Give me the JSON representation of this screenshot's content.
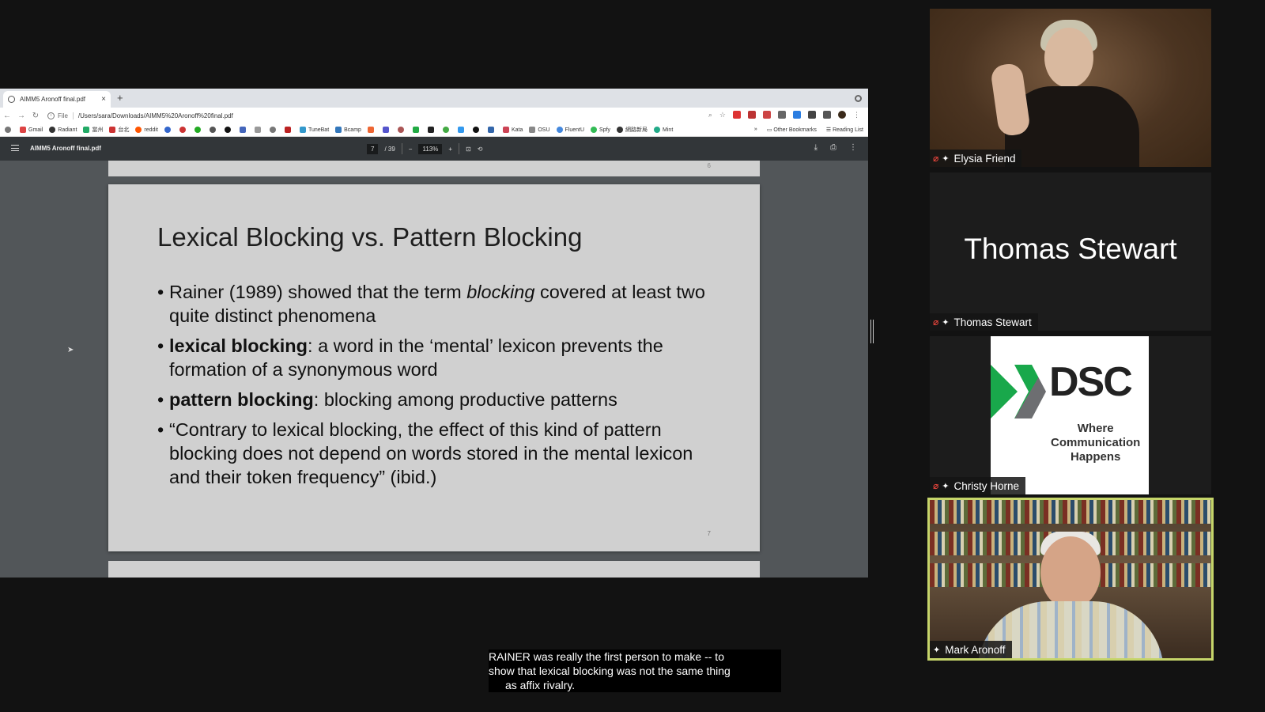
{
  "browser": {
    "tab_title": "AIMM5 Aronoff final.pdf",
    "new_tab": "+",
    "close": "×",
    "address_scheme": "File",
    "address_url": "/Users/sara/Downloads/AIMM5%20Aronoff%20final.pdf",
    "bookmarks": [
      "Gmail",
      "Radiant",
      "當州",
      "台北",
      "reddit",
      "TuneBat",
      "Bcamp",
      "Kata",
      "OSU",
      "FluentU",
      "Spfy",
      "網路新局",
      "Mint"
    ],
    "bookmarks_overflow": "»",
    "other_bookmarks": "Other Bookmarks",
    "reading_list": "Reading List"
  },
  "pdf_toolbar": {
    "filename": "AIMM5 Aronoff final.pdf",
    "current_page": "7",
    "total_pages": "/ 39",
    "zoom": "113%",
    "zoom_out": "−",
    "zoom_in": "+"
  },
  "slide": {
    "prev_page_number": "6",
    "title": "Lexical Blocking vs. Pattern Blocking",
    "bullet1_a": "Rainer (1989) showed that the term ",
    "bullet1_em": "blocking",
    "bullet1_b": " covered at least two quite distinct phenomena",
    "bullet2_bold": "lexical blocking",
    "bullet2_rest": ": a word in the ‘mental’ lexicon prevents the formation of a synonymous word",
    "bullet3_bold": "pattern blocking",
    "bullet3_rest": ": blocking among productive patterns",
    "bullet4": "“Contrary to lexical blocking, the effect of this kind of pattern blocking does not depend on words stored in the mental lexicon and their token frequency” (ibid.)",
    "page_number": "7"
  },
  "participants": [
    {
      "name": "Elysia Friend",
      "muted": true
    },
    {
      "name": "Thomas Stewart",
      "muted": true,
      "display_name": "Thomas Stewart"
    },
    {
      "name": "Christy Horne",
      "muted": true,
      "logo_word": "DSC",
      "logo_tagline_1": "Where",
      "logo_tagline_2": "Communication",
      "logo_tagline_3": "Happens"
    },
    {
      "name": "Mark Aronoff",
      "muted": false,
      "active_speaker": true
    }
  ],
  "captions": {
    "line1": "RAINER was really the first person to make -- to",
    "line2": "show that lexical blocking was not the same thing",
    "line3": "as affix rivalry."
  },
  "colors": {
    "active_speaker_border": "#c6d56a",
    "mic_off": "#e8453c",
    "pdf_toolbar": "#323639",
    "pdf_viewer_bg": "#525659",
    "dsc_green": "#19a84b"
  }
}
